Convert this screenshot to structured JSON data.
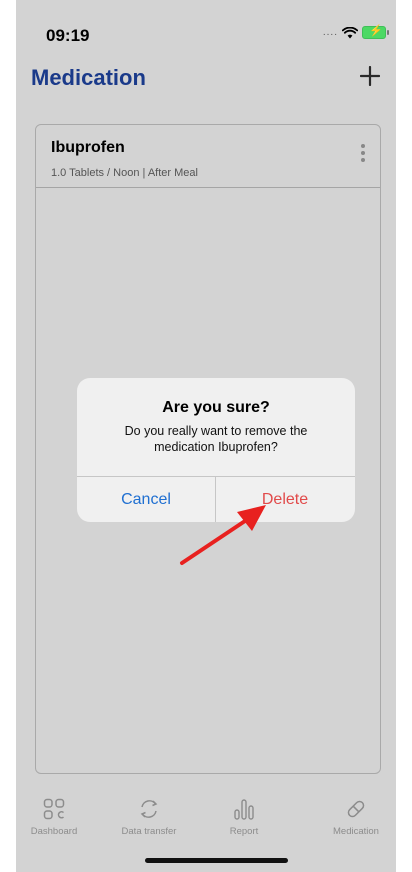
{
  "status_bar": {
    "time": "09:19",
    "signal": "....",
    "wifi_icon": "wifi-icon",
    "battery_icon": "battery-charging-icon"
  },
  "header": {
    "title": "Medication",
    "add_icon": "plus-icon"
  },
  "medications": [
    {
      "name": "Ibuprofen",
      "detail": "1.0 Tablets / Noon | After Meal"
    }
  ],
  "tabs": [
    {
      "label": "Dashboard",
      "icon": "grid-icon"
    },
    {
      "label": "Data transfer",
      "icon": "sync-icon"
    },
    {
      "label": "Report",
      "icon": "bar-chart-icon"
    },
    {
      "label": "Medication",
      "icon": "pill-icon"
    }
  ],
  "alert": {
    "title": "Are you sure?",
    "message": "Do you really want to remove the medication Ibuprofen?",
    "cancel_label": "Cancel",
    "delete_label": "Delete"
  },
  "colors": {
    "title_blue": "#1a3a8a",
    "cancel_blue": "#1f6fd1",
    "delete_red": "#e14a4a",
    "annotation_arrow": "#e8211f",
    "background_dim": "#d3d3d3"
  }
}
